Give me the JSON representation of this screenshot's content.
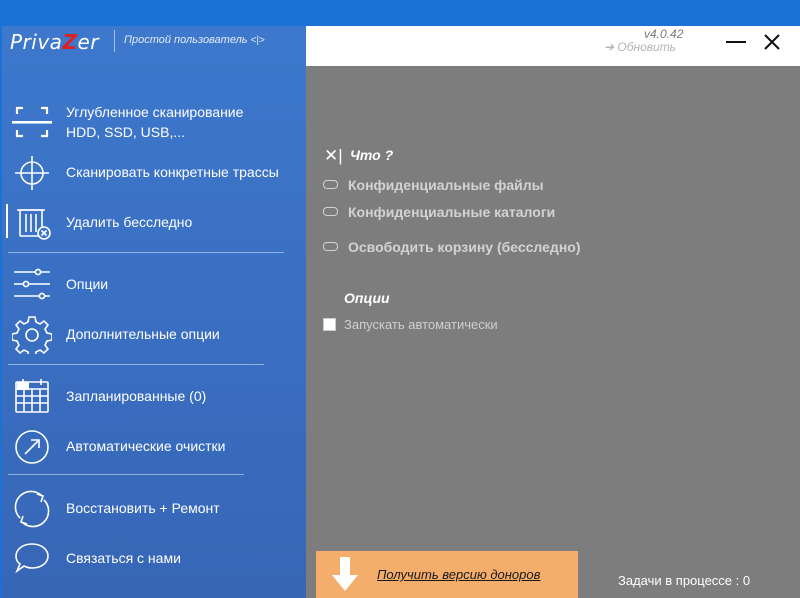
{
  "app": {
    "logo_prefix": "Priva",
    "logo_z": "Z",
    "logo_suffix": "er",
    "user_mode": "Простой пользователь",
    "user_mode_arrows": "<|>",
    "version": "v4.0.42",
    "update": "➔ Обновить"
  },
  "sidebar": {
    "items": [
      {
        "line1": "Углубленное сканирование",
        "line2": "HDD, SSD, USB,...",
        "icon": "scan-frame-icon"
      },
      {
        "label": "Сканировать конкретные трассы",
        "icon": "crosshair-icon"
      },
      {
        "label": "Удалить бесследно",
        "icon": "trash-delete-icon"
      },
      {
        "label": "Опции",
        "icon": "sliders-icon"
      },
      {
        "label": "Дополнительные опции",
        "icon": "gear-icon"
      },
      {
        "label": "Запланированные (0)",
        "icon": "calendar-icon"
      },
      {
        "label": "Автоматические очистки",
        "icon": "auto-arrow-icon"
      },
      {
        "label": "Восстановить + Ремонт",
        "icon": "restore-cycle-icon"
      },
      {
        "label": "Связаться с нами",
        "icon": "chat-bubble-icon"
      }
    ]
  },
  "main": {
    "what_label": "Что ?",
    "what_mark": "✕|",
    "options": [
      "Конфиденциальные файлы",
      "Конфиденциальные каталоги",
      "Освободить корзину (бесследно)"
    ],
    "options_title": "Опции",
    "auto_start_label": "Запускать автоматически",
    "auto_start_checked": false
  },
  "footer": {
    "donor_label": "Получить версию доноров",
    "tasks_label": "Задачи в процессе : 0"
  },
  "colors": {
    "titlebar": "#1a72d6",
    "sidebar": "#3d78cc",
    "main_bg": "#7d7d7d",
    "donor_bg": "#f5ad6c",
    "logo_z": "#e02020"
  }
}
